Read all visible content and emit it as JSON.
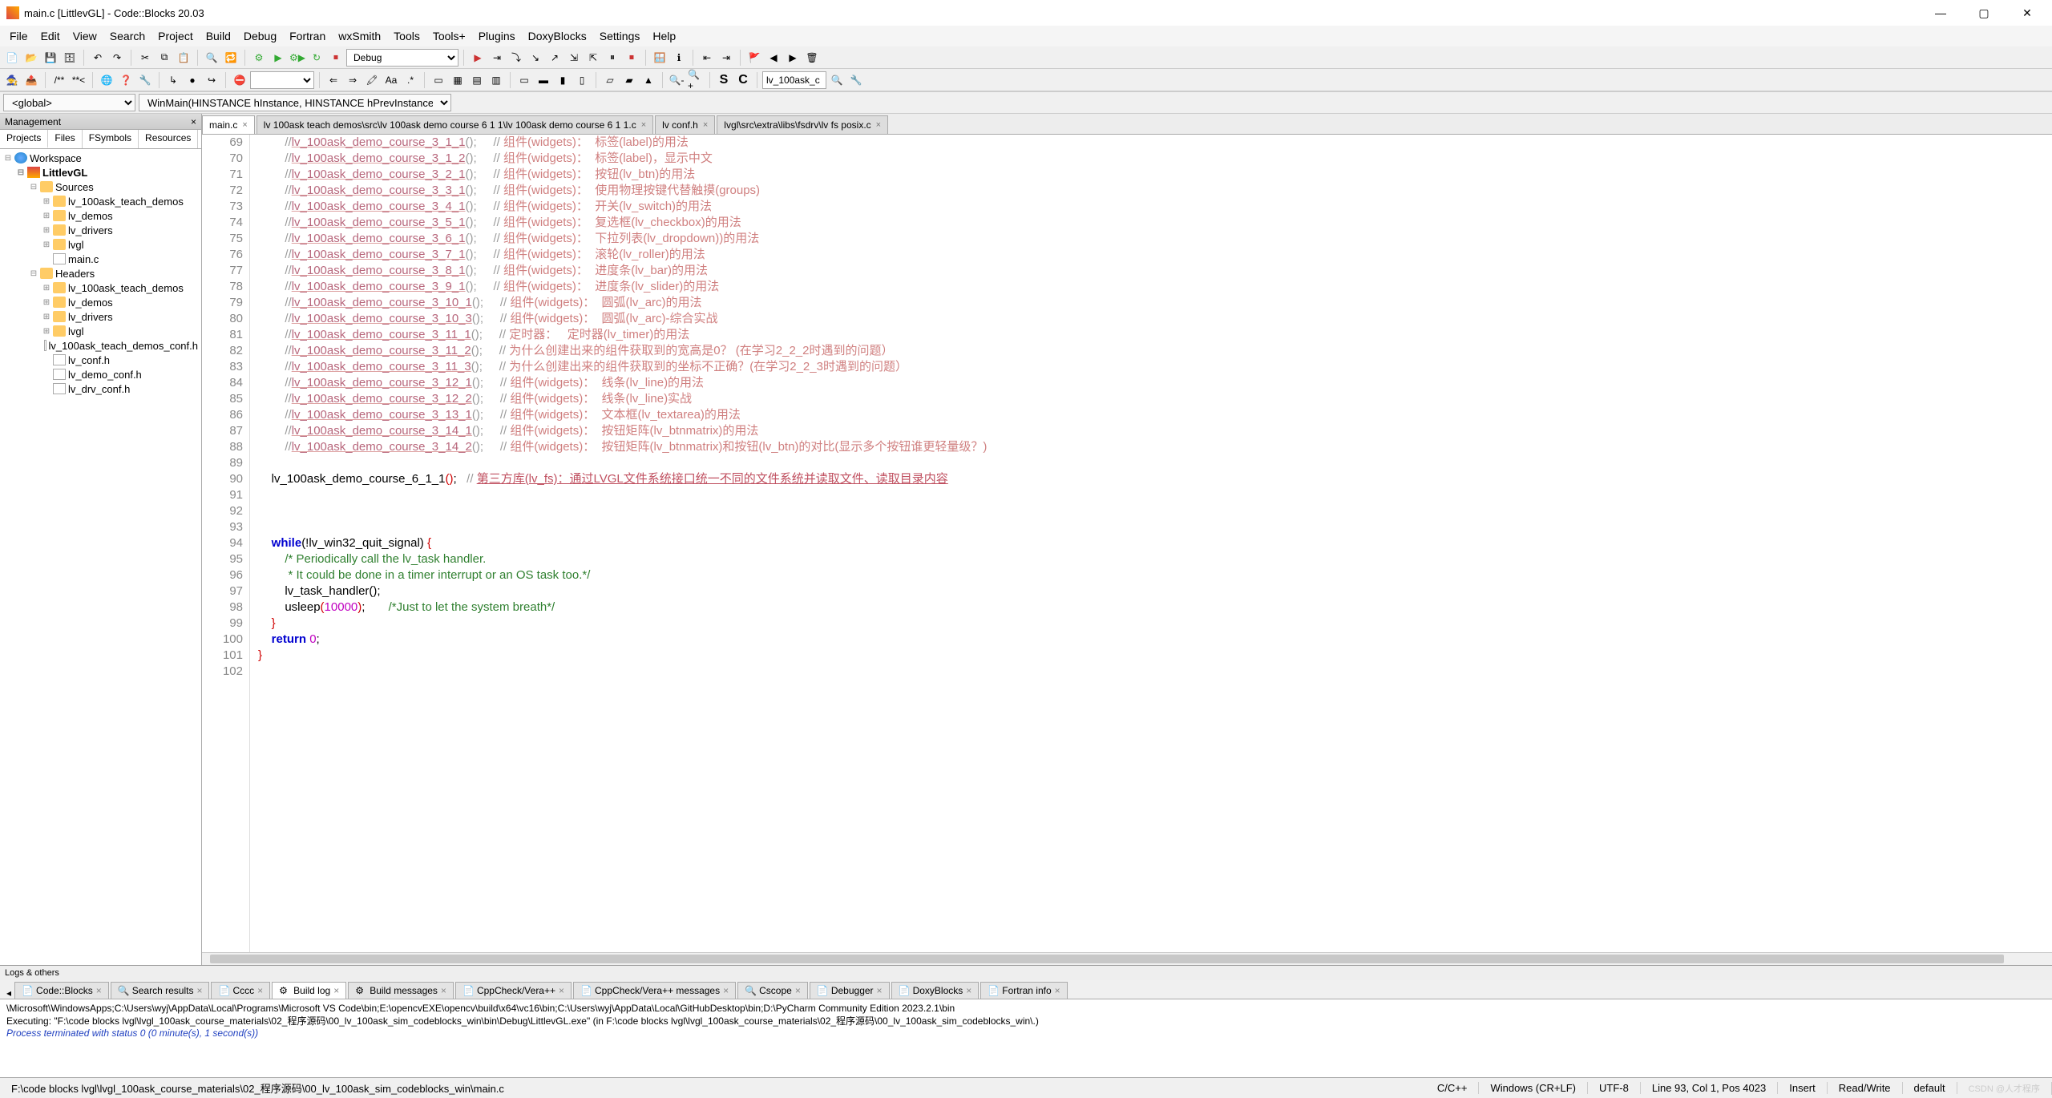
{
  "window": {
    "title": "main.c [LittlevGL] - Code::Blocks 20.03"
  },
  "menus": [
    "File",
    "Edit",
    "View",
    "Search",
    "Project",
    "Build",
    "Debug",
    "Fortran",
    "wxSmith",
    "Tools",
    "Tools+",
    "Plugins",
    "DoxyBlocks",
    "Settings",
    "Help"
  ],
  "toolbar": {
    "build_target": "Debug",
    "search_box": "lv_100ask_c"
  },
  "scope": {
    "global": "<global>",
    "func": "WinMain(HINSTANCE hInstance, HINSTANCE hPrevInstance, LPSTR szCmd"
  },
  "mgmt": {
    "title": "Management",
    "tabs": [
      "Projects",
      "Files",
      "FSymbols",
      "Resources"
    ],
    "tree": [
      {
        "d": 0,
        "ic": "ws",
        "label": "Workspace",
        "exp": "-"
      },
      {
        "d": 1,
        "ic": "prj",
        "label": "LittlevGL",
        "exp": "-",
        "bold": true
      },
      {
        "d": 2,
        "ic": "fold",
        "label": "Sources",
        "exp": "-"
      },
      {
        "d": 3,
        "ic": "fold",
        "label": "lv_100ask_teach_demos",
        "exp": "+"
      },
      {
        "d": 3,
        "ic": "fold",
        "label": "lv_demos",
        "exp": "+"
      },
      {
        "d": 3,
        "ic": "fold",
        "label": "lv_drivers",
        "exp": "+"
      },
      {
        "d": 3,
        "ic": "fold",
        "label": "lvgl",
        "exp": "+"
      },
      {
        "d": 3,
        "ic": "file",
        "label": "main.c",
        "exp": " "
      },
      {
        "d": 2,
        "ic": "fold",
        "label": "Headers",
        "exp": "-"
      },
      {
        "d": 3,
        "ic": "fold",
        "label": "lv_100ask_teach_demos",
        "exp": "+"
      },
      {
        "d": 3,
        "ic": "fold",
        "label": "lv_demos",
        "exp": "+"
      },
      {
        "d": 3,
        "ic": "fold",
        "label": "lv_drivers",
        "exp": "+"
      },
      {
        "d": 3,
        "ic": "fold",
        "label": "lvgl",
        "exp": "+"
      },
      {
        "d": 3,
        "ic": "file",
        "label": "lv_100ask_teach_demos_conf.h",
        "exp": " "
      },
      {
        "d": 3,
        "ic": "file",
        "label": "lv_conf.h",
        "exp": " "
      },
      {
        "d": 3,
        "ic": "file",
        "label": "lv_demo_conf.h",
        "exp": " "
      },
      {
        "d": 3,
        "ic": "file",
        "label": "lv_drv_conf.h",
        "exp": " "
      }
    ]
  },
  "editor_tabs": [
    {
      "label": "main.c",
      "active": true
    },
    {
      "label": "lv 100ask teach demos\\src\\lv 100ask demo course 6 1 1\\lv 100ask demo course 6 1 1.c"
    },
    {
      "label": "lv conf.h"
    },
    {
      "label": "lvgl\\src\\extra\\libs\\fsdrv\\lv fs posix.c"
    }
  ],
  "code": {
    "first_line": 69,
    "lines": [
      {
        "t": "cm",
        "f": "lv_100ask_demo_course_3_1_1",
        "zh": "组件(widgets)：  标签(label)的用法"
      },
      {
        "t": "cm",
        "f": "lv_100ask_demo_course_3_1_2",
        "zh": "组件(widgets)：  标签(label)，显示中文"
      },
      {
        "t": "cm",
        "f": "lv_100ask_demo_course_3_2_1",
        "zh": "组件(widgets)：  按钮(lv_btn)的用法"
      },
      {
        "t": "cm",
        "f": "lv_100ask_demo_course_3_3_1",
        "zh": "组件(widgets)：  使用物理按键代替触摸(groups)"
      },
      {
        "t": "cm",
        "f": "lv_100ask_demo_course_3_4_1",
        "zh": "组件(widgets)：  开关(lv_switch)的用法"
      },
      {
        "t": "cm",
        "f": "lv_100ask_demo_course_3_5_1",
        "zh": "组件(widgets)：  复选框(lv_checkbox)的用法"
      },
      {
        "t": "cm",
        "f": "lv_100ask_demo_course_3_6_1",
        "zh": "组件(widgets)：  下拉列表(lv_dropdown))的用法"
      },
      {
        "t": "cm",
        "f": "lv_100ask_demo_course_3_7_1",
        "zh": "组件(widgets)：  滚轮(lv_roller)的用法"
      },
      {
        "t": "cm",
        "f": "lv_100ask_demo_course_3_8_1",
        "zh": "组件(widgets)：  进度条(lv_bar)的用法"
      },
      {
        "t": "cm",
        "f": "lv_100ask_demo_course_3_9_1",
        "zh": "组件(widgets)：  进度条(lv_slider)的用法"
      },
      {
        "t": "cm",
        "f": "lv_100ask_demo_course_3_10_1",
        "zh": "组件(widgets)：  圆弧(lv_arc)的用法"
      },
      {
        "t": "cm",
        "f": "lv_100ask_demo_course_3_10_3",
        "zh": "组件(widgets)：  圆弧(lv_arc)-综合实战"
      },
      {
        "t": "cm",
        "f": "lv_100ask_demo_course_3_11_1",
        "zh": "定时器：   定时器(lv_timer)的用法"
      },
      {
        "t": "cm",
        "f": "lv_100ask_demo_course_3_11_2",
        "zh": "为什么创建出来的组件获取到的宽高是0？ (在学习2_2_2时遇到的问题）"
      },
      {
        "t": "cm",
        "f": "lv_100ask_demo_course_3_11_3",
        "zh": "为什么创建出来的组件获取到的坐标不正确？(在学习2_2_3时遇到的问题）"
      },
      {
        "t": "cm",
        "f": "lv_100ask_demo_course_3_12_1",
        "zh": "组件(widgets)：  线条(lv_line)的用法"
      },
      {
        "t": "cm",
        "f": "lv_100ask_demo_course_3_12_2",
        "zh": "组件(widgets)：  线条(lv_line)实战"
      },
      {
        "t": "cm",
        "f": "lv_100ask_demo_course_3_13_1",
        "zh": "组件(widgets)：  文本框(lv_textarea)的用法"
      },
      {
        "t": "cm",
        "f": "lv_100ask_demo_course_3_14_1",
        "zh": "组件(widgets)：  按钮矩阵(lv_btnmatrix)的用法"
      },
      {
        "t": "cm",
        "f": "lv_100ask_demo_course_3_14_2",
        "zh": "组件(widgets)：  按钮矩阵(lv_btnmatrix)和按钮(lv_btn)的对比(显示多个按钮谁更轻量级？)"
      },
      {
        "t": "blank"
      },
      {
        "t": "call",
        "fn": "lv_100ask_demo_course_6_1_1",
        "tail": "();",
        "cm": "// 第三方库(lv_fs)：通过LVGL文件系统接口统一不同的文件系统并读取文件、读取目录内容"
      },
      {
        "t": "blank"
      },
      {
        "t": "blank"
      },
      {
        "t": "blank"
      },
      {
        "t": "while"
      },
      {
        "t": "green",
        "txt": "        /* Periodically call the lv_task handler."
      },
      {
        "t": "green",
        "txt": "         * It could be done in a timer interrupt or an OS task too.*/"
      },
      {
        "t": "plain",
        "txt": "        lv_task_handler();"
      },
      {
        "t": "usleep"
      },
      {
        "t": "close_inner"
      },
      {
        "t": "return"
      },
      {
        "t": "close_outer"
      },
      {
        "t": "blank"
      }
    ]
  },
  "logs": {
    "title": "Logs & others",
    "tabs": [
      "Code::Blocks",
      "Search results",
      "Cccc",
      "Build log",
      "Build messages",
      "CppCheck/Vera++",
      "CppCheck/Vera++ messages",
      "Cscope",
      "Debugger",
      "DoxyBlocks",
      "Fortran info"
    ],
    "active_tab": 3,
    "body1": "\\Microsoft\\WindowsApps;C:\\Users\\wyj\\AppData\\Local\\Programs\\Microsoft VS Code\\bin;E:\\opencvEXE\\opencv\\build\\x64\\vc16\\bin;C:\\Users\\wyj\\AppData\\Local\\GitHubDesktop\\bin;D:\\PyCharm Community Edition 2023.2.1\\bin",
    "body2": "Executing: \"F:\\code blocks lvgl\\lvgl_100ask_course_materials\\02_程序源码\\00_lv_100ask_sim_codeblocks_win\\bin\\Debug\\LittlevGL.exe\"  (in F:\\code blocks lvgl\\lvgl_100ask_course_materials\\02_程序源码\\00_lv_100ask_sim_codeblocks_win\\.)",
    "body3": "Process terminated with status 0 (0 minute(s), 1 second(s))"
  },
  "status": {
    "path": "F:\\code blocks lvgl\\lvgl_100ask_course_materials\\02_程序源码\\00_lv_100ask_sim_codeblocks_win\\main.c",
    "lang": "C/C++",
    "eol": "Windows (CR+LF)",
    "enc": "UTF-8",
    "pos": "Line 93, Col 1, Pos 4023",
    "mode": "Insert",
    "rw": "Read/Write",
    "def": "default"
  },
  "watermark": "CSDN @人才程序"
}
